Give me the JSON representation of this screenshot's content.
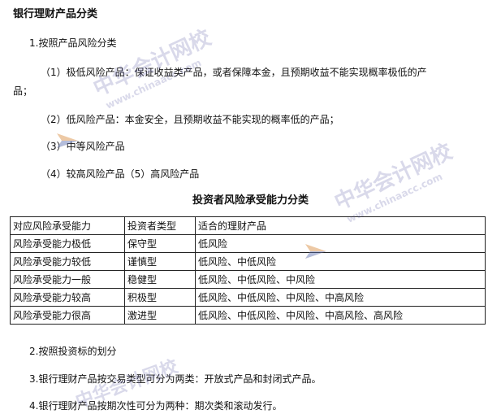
{
  "heading": "银行理财产品分类",
  "section1": {
    "title": "1.按照产品风险分类",
    "item1_line1": "（1）极低风险产品：保证收益类产品，或者保障本金，且预期收益不能实现概率极低的产",
    "item1_line2": "品；",
    "item2": "（2）低风险产品：本金安全，且预期收益不能实现的概率低的产品；",
    "item3": "（3）中等风险产品",
    "item4": "（4）较高风险产品（5）高风险产品"
  },
  "table": {
    "title": "投资者风险承受能力分类",
    "headers": [
      "对应风险承受能力",
      "投资者类型",
      "适合的理财产品"
    ],
    "rows": [
      [
        "风险承受能力极低",
        "保守型",
        "低风险"
      ],
      [
        "风险承受能力较低",
        "谨慎型",
        "低风险、中低风险"
      ],
      [
        "风险承受能力一般",
        "稳健型",
        "低风险、中低风险、中风险"
      ],
      [
        "风险承受能力较高",
        "积极型",
        "低风险、中低风险、中风险、中高风险"
      ],
      [
        "风险承受能力很高",
        "激进型",
        "低风险、中低风险、中风险、中高风险、高风险"
      ]
    ]
  },
  "section2": "2.按照投资标的划分",
  "section3": "3.银行理财产品按交易类型可分为两类：开放式产品和封闭式产品。",
  "section4": "4.银行理财产品按期次性可分为两种：期次类和滚动发行。",
  "watermark": {
    "text": "中华会计网校",
    "url": "www.chinaacc.com"
  }
}
